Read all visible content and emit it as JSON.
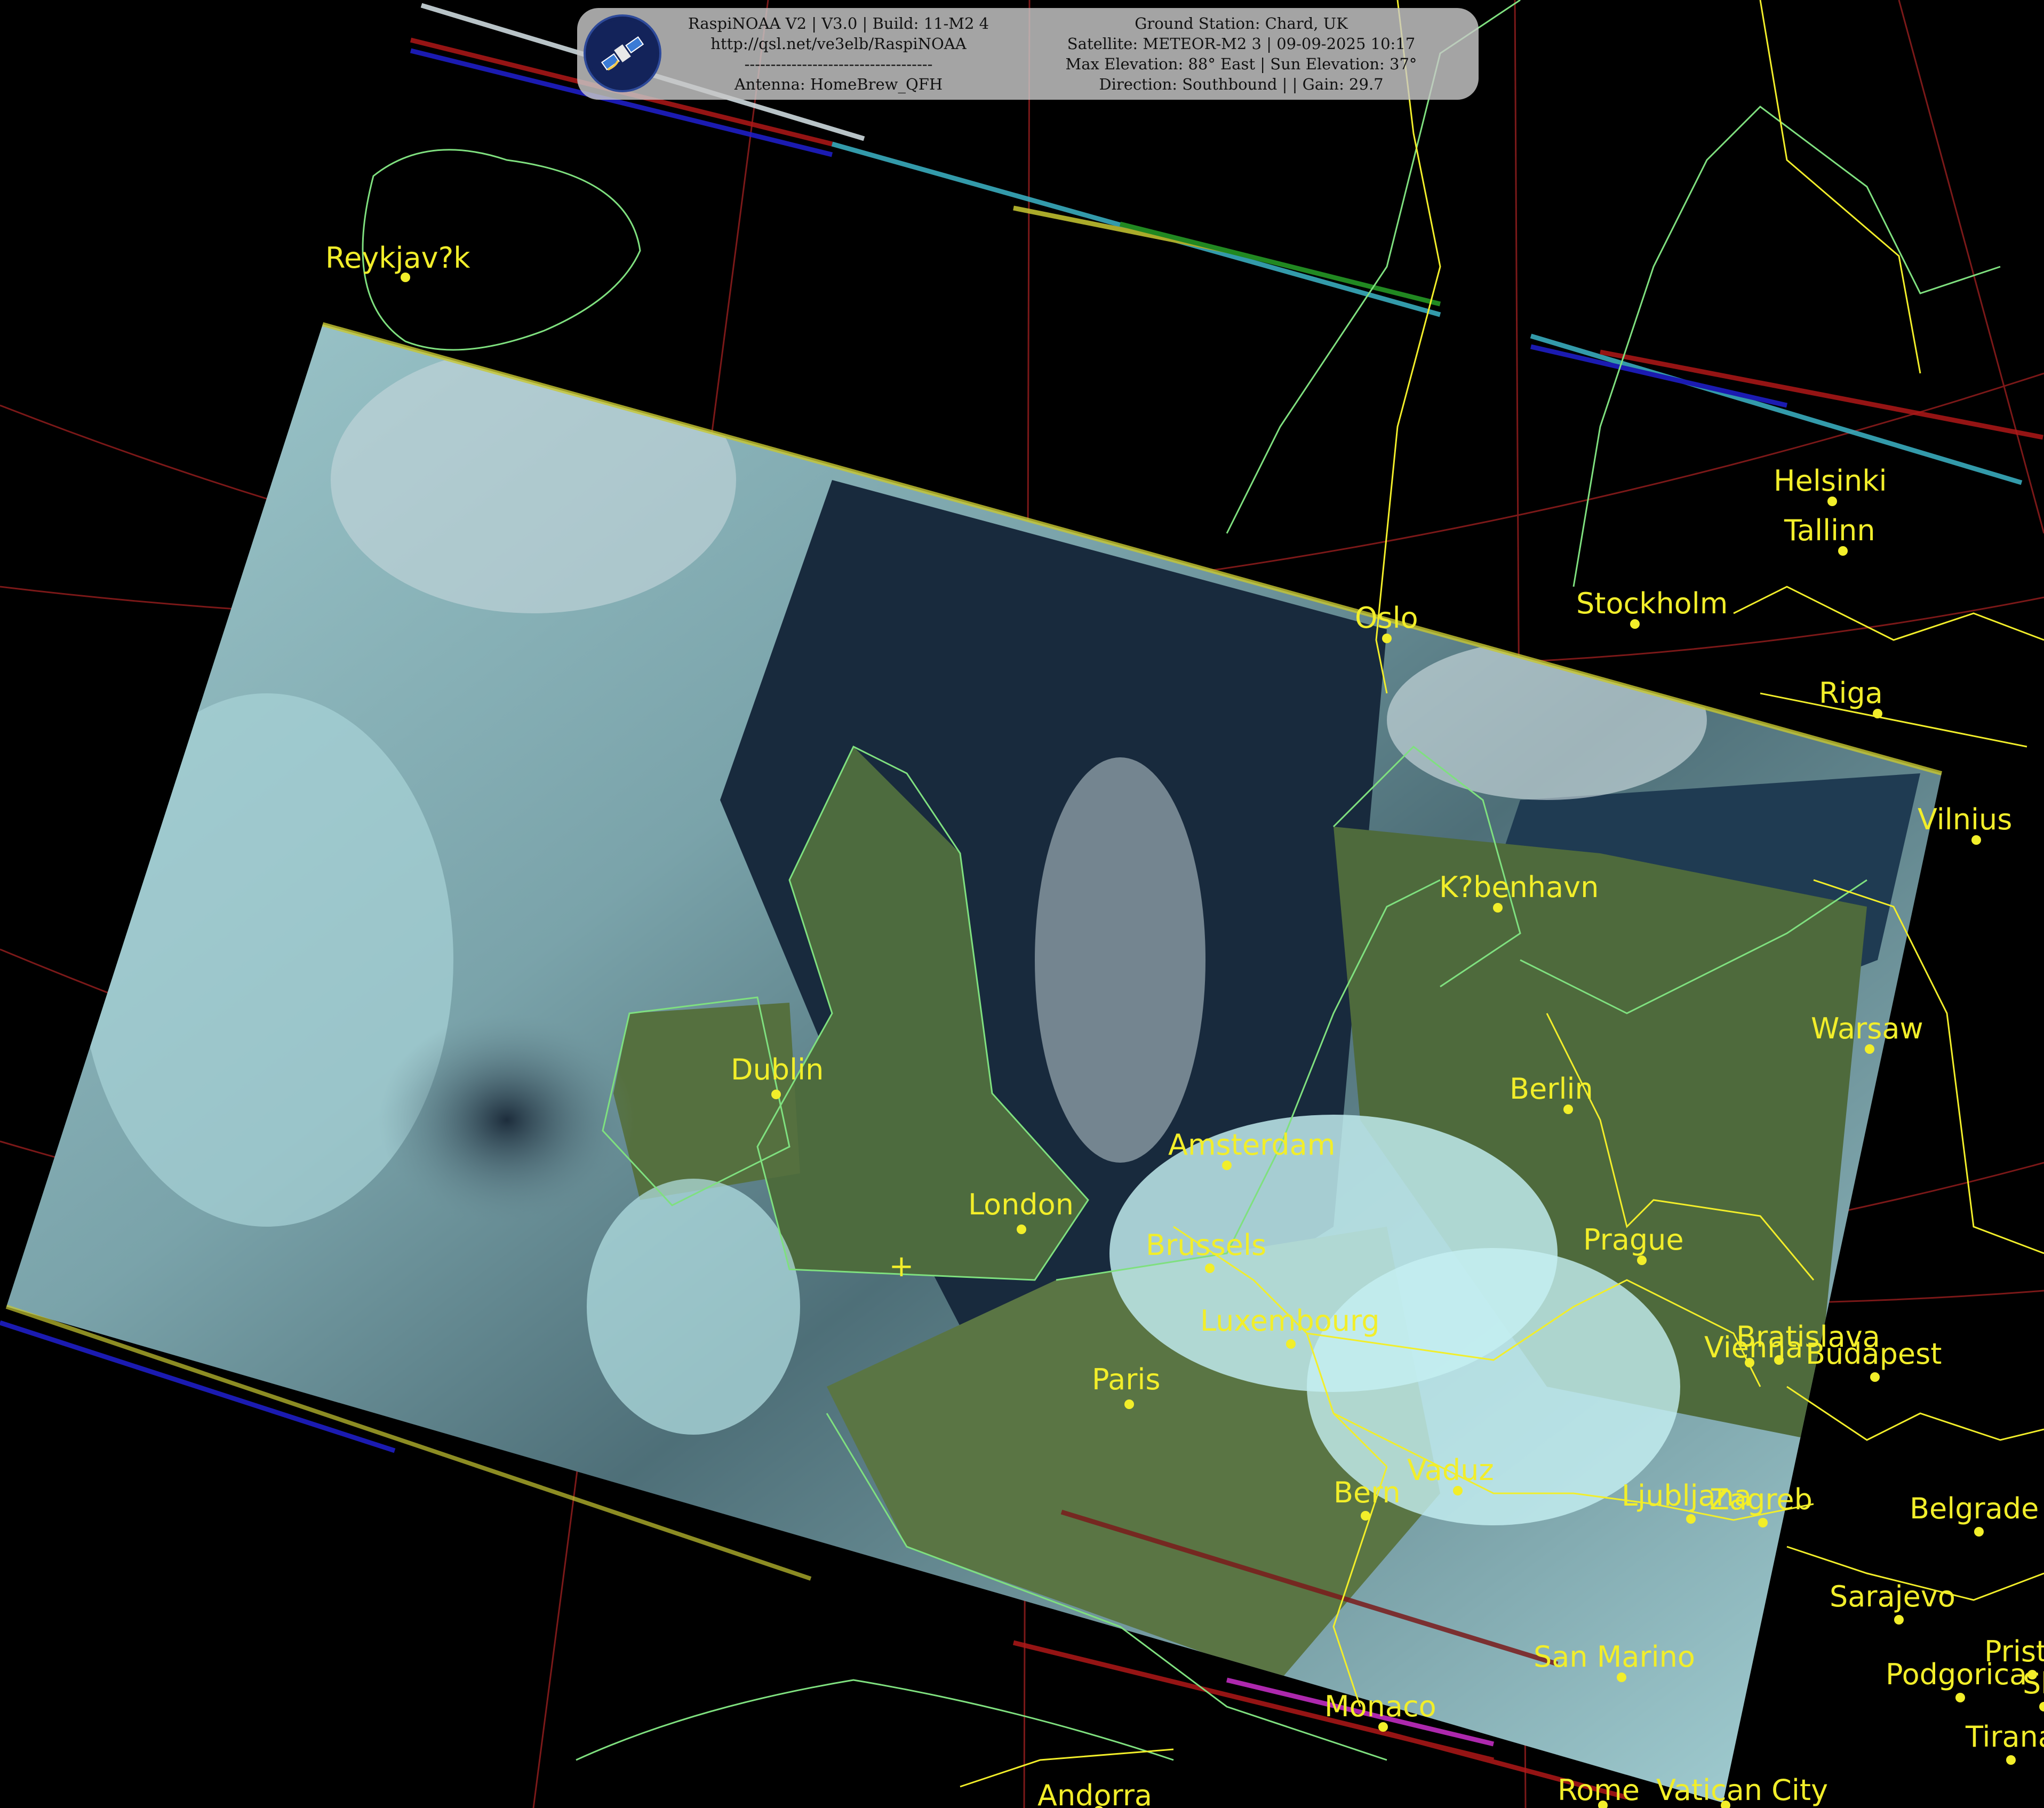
{
  "banner": {
    "left_lines": [
      "RaspiNOAA V2 | V3.0 | Build: 11-M2 4",
      "http://qsl.net/ve3elb/RaspiNOAA",
      "------------------------------------",
      "Antenna: HomeBrew_QFH"
    ],
    "right_lines": [
      "Ground Station: Chard, UK",
      "Satellite: METEOR-M2 3 | 09-09-2025 10:17",
      "Max Elevation: 88° East | Sun Elevation: 37°",
      "Direction: Southbound | | Gain: 29.7"
    ],
    "logo_icon": "satellite-icon"
  },
  "map": {
    "station_marker": "+",
    "colors": {
      "background": "#000000",
      "coastline": "#7fe07f",
      "border": "#f2ee2a",
      "graticule": "#b02020",
      "label": "#f2ee2a"
    },
    "cities": [
      {
        "name": "Reykjav?k"
      },
      {
        "name": "Helsinki"
      },
      {
        "name": "Tallinn"
      },
      {
        "name": "Stockholm"
      },
      {
        "name": "Oslo"
      },
      {
        "name": "Riga"
      },
      {
        "name": "Vilnius"
      },
      {
        "name": "K?benhavn"
      },
      {
        "name": "Warsaw"
      },
      {
        "name": "Dublin"
      },
      {
        "name": "Berlin"
      },
      {
        "name": "Amsterdam"
      },
      {
        "name": "London"
      },
      {
        "name": "Brussels"
      },
      {
        "name": "Prague"
      },
      {
        "name": "Luxembourg"
      },
      {
        "name": "Vienna"
      },
      {
        "name": "Bratislava"
      },
      {
        "name": "Budapest"
      },
      {
        "name": "Paris"
      },
      {
        "name": "Vaduz"
      },
      {
        "name": "Bern"
      },
      {
        "name": "Ljubljana"
      },
      {
        "name": "Zagreb"
      },
      {
        "name": "Belgrade"
      },
      {
        "name": "Sarajevo"
      },
      {
        "name": "Pristina"
      },
      {
        "name": "San Marino"
      },
      {
        "name": "Podgorica"
      },
      {
        "name": "Monaco"
      },
      {
        "name": "Tirana"
      },
      {
        "name": "Vatican City"
      },
      {
        "name": "Rome"
      },
      {
        "name": "Andorra"
      },
      {
        "name": "Skopje"
      }
    ]
  }
}
